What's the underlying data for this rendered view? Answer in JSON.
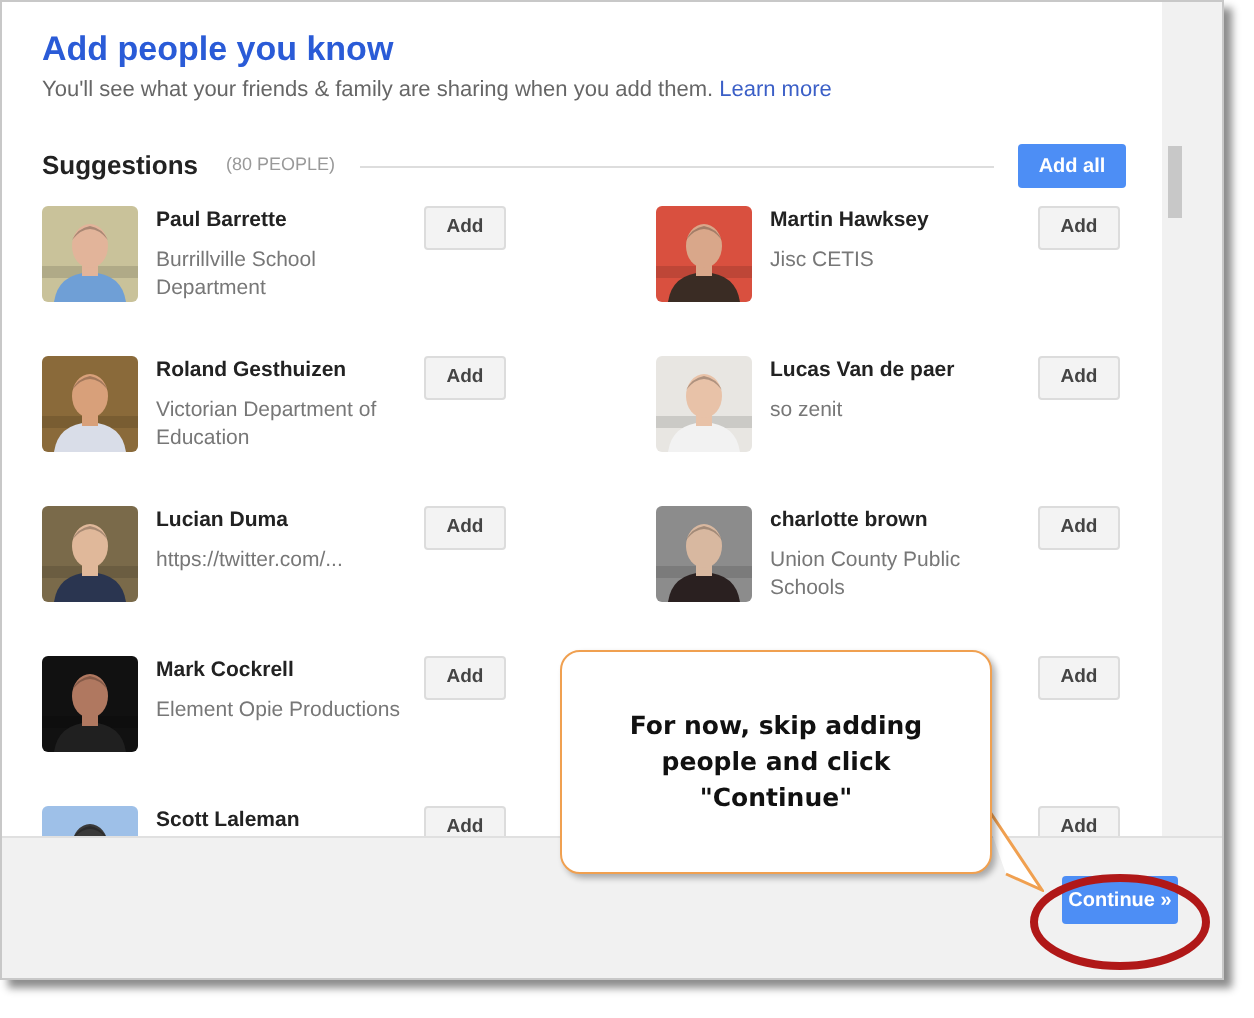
{
  "dialog": {
    "title": "Add people you know",
    "subtitle": "You'll see what your friends & family are sharing when you add them.",
    "learn_more": "Learn more",
    "suggestions": {
      "heading": "Suggestions",
      "count": "(80 PEOPLE)",
      "add_all": "Add all"
    },
    "people": [
      {
        "name": "Paul Barrette",
        "org": "Burrillville School Department",
        "add": "Add"
      },
      {
        "name": "Martin Hawksey",
        "org": "Jisc CETIS",
        "add": "Add"
      },
      {
        "name": "Roland Gesthuizen",
        "org": "Victorian Department of Education",
        "add": "Add"
      },
      {
        "name": "Lucas Van de paer",
        "org": "so zenit",
        "add": "Add"
      },
      {
        "name": "Lucian Duma",
        "org": "https://twitter.com/...",
        "add": "Add"
      },
      {
        "name": "charlotte brown",
        "org": "Union County Public Schools",
        "add": "Add"
      },
      {
        "name": "Mark Cockrell",
        "org": "Element Opie Productions",
        "add": "Add"
      },
      {
        "add": "Add"
      },
      {
        "name": "Scott Laleman",
        "add": "Add"
      },
      {
        "add": "Add"
      }
    ],
    "continue": "Continue »"
  },
  "callout": {
    "text": "For now, skip adding people and click \"Continue\""
  }
}
